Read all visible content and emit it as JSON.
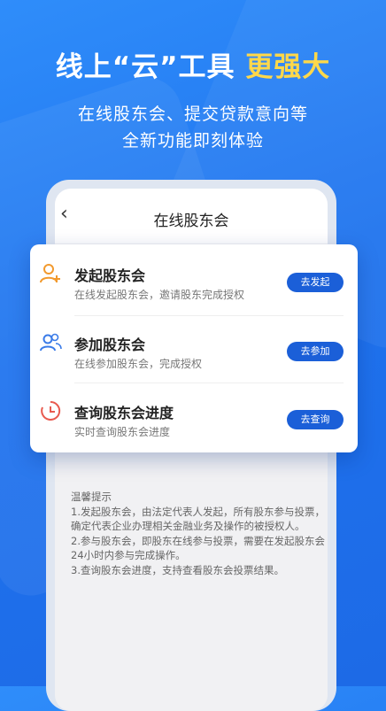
{
  "headline": {
    "part1": "线上“云”工具",
    "accent": "更强大"
  },
  "subtitle": {
    "line1": "在线股东会、提交贷款意向等",
    "line2": "全新功能即刻体验"
  },
  "nav": {
    "back": "‹",
    "title": "在线股东会"
  },
  "items": [
    {
      "title": "发起股东会",
      "desc": "在线发起股东会，邀请股东完成授权",
      "button": "去发起",
      "icon": "user-add-icon",
      "icon_color": "#f29a2e"
    },
    {
      "title": "参加股东会",
      "desc": "在线参加股东会，完成授权",
      "button": "去参加",
      "icon": "users-icon",
      "icon_color": "#3a7be8"
    },
    {
      "title": "查询股东会进度",
      "desc": "实时查询股东会进度",
      "button": "去查询",
      "icon": "clock-icon",
      "icon_color": "#e85a4f"
    }
  ],
  "tips": {
    "title": "温馨提示",
    "lines": [
      "1.发起股东会，由法定代表人发起，所有股东参与投票，确定代表企业办理相关金融业务及操作的被授权人。",
      "2.参与股东会，即股东在线参与投票，需要在发起股东会24小时内参与完成操作。",
      "3.查询股东会进度，支持查看股东会投票结果。"
    ]
  },
  "colors": {
    "background": "#1f73ee",
    "accent": "#ffd84a",
    "button": "#1b5fd8"
  }
}
